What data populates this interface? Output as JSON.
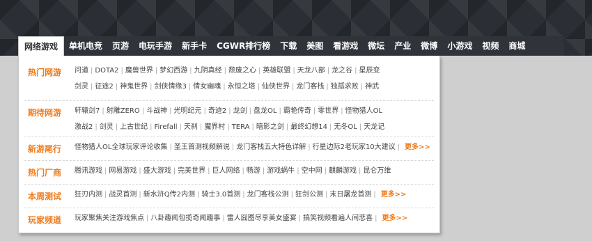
{
  "nav": {
    "items": [
      "网络游戏",
      "单机电竞",
      "页游",
      "电玩手游",
      "新手卡",
      "CGWR排行榜",
      "下载",
      "美图",
      "看游戏",
      "微坛",
      "产业",
      "微博",
      "小游戏",
      "视频",
      "商城"
    ],
    "active_index": 0
  },
  "panel": {
    "rows": [
      {
        "category": "热门网游",
        "lines": [
          [
            "问道",
            "DOTA2",
            "魔兽世界",
            "梦幻西游",
            "九阴真经",
            "颓废之心",
            "英雄联盟",
            "天龙八部",
            "龙之谷",
            "星辰变"
          ],
          [
            "剑灵",
            "征途2",
            "神鬼世界",
            "剑侠情缘3",
            "倩女幽魂",
            "永恒之塔",
            "仙侠世界",
            "龙门客栈",
            "独孤求败",
            "神武"
          ]
        ]
      },
      {
        "category": "期待网游",
        "lines": [
          [
            "轩辕剑7",
            "射雕ZERO",
            "斗战神",
            "光明纪元",
            "奇迹2",
            "龙剑",
            "盘龙OL",
            "霸艳传奇",
            "零世界",
            "怪物猎人OL"
          ],
          [
            "激战2",
            "剑灵",
            "上古世纪",
            "Firefall",
            "天刹",
            "魔界村",
            "TERA",
            "暗影之剑",
            "最终幻想14",
            "无冬OL",
            "天龙记"
          ]
        ]
      },
      {
        "category": "新游尾行",
        "lines": [
          [
            "怪物猎人OL全球玩家评论收集",
            "圣王首测视频解说",
            "龙门客栈五大特色详解",
            "行星边际2老玩家10大建议"
          ]
        ],
        "more": "更多>>"
      },
      {
        "category": "热门厂商",
        "lines": [
          [
            "腾讯游戏",
            "网易游戏",
            "盛大游戏",
            "完美世界",
            "巨人网络",
            "畅游",
            "游戏蜗牛",
            "空中网",
            "麒麟游戏",
            "昆仑万维"
          ]
        ]
      },
      {
        "category": "本周测试",
        "lines": [
          [
            "狂刃内测",
            "战灵首测",
            "新水浒Q传2内测",
            "骑士3.0首测",
            "龙门客栈公测",
            "狂剑公测",
            "末日屠龙首测"
          ]
        ],
        "more": "更多>>"
      },
      {
        "category": "玩家频道",
        "lines": [
          [
            "玩家聚焦关注游戏焦点",
            "八卦趣闻包揽奇闻趣事",
            "雷人囧图尽享美女盛宴",
            "搞笑视频看遍人间悲喜"
          ]
        ],
        "more": "更多>>"
      }
    ]
  },
  "colors": {
    "accent": "#f07a1a",
    "nav_bg": "#30333a",
    "page_bg": "#cfcfcf"
  }
}
